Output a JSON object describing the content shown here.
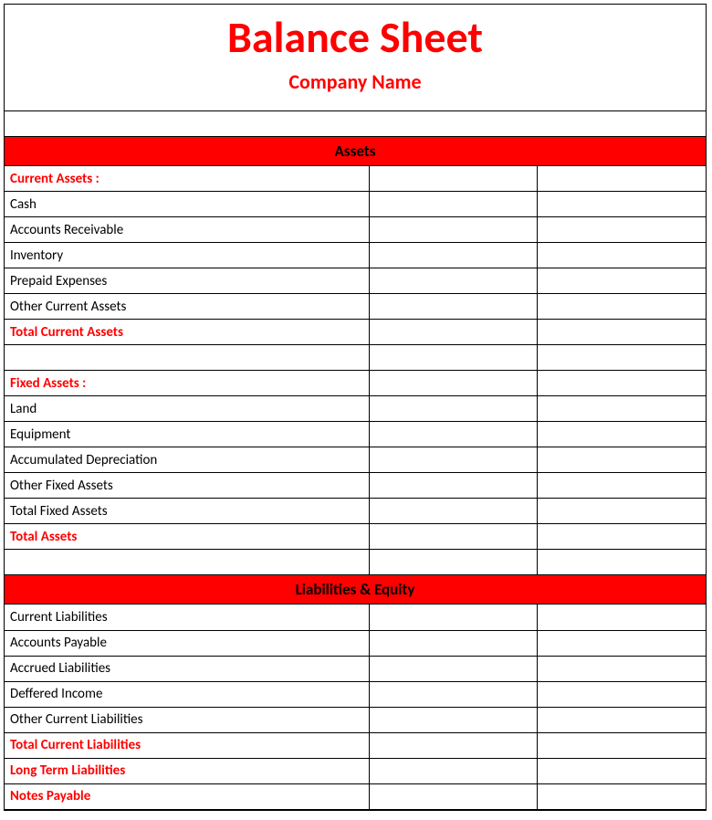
{
  "header": {
    "title": "Balance Sheet",
    "subtitle": "Company Name"
  },
  "sections": {
    "assets": {
      "heading": "Assets",
      "rows": [
        {
          "label": "Current Assets :",
          "style": "red-bold",
          "col_a": "",
          "col_b": ""
        },
        {
          "label": "Cash",
          "style": "plain",
          "col_a": "",
          "col_b": ""
        },
        {
          "label": "Accounts Receivable",
          "style": "plain",
          "col_a": "",
          "col_b": ""
        },
        {
          "label": "Inventory",
          "style": "plain",
          "col_a": "",
          "col_b": ""
        },
        {
          "label": "Prepaid Expenses",
          "style": "plain",
          "col_a": "",
          "col_b": ""
        },
        {
          "label": "Other Current Assets",
          "style": "plain",
          "col_a": "",
          "col_b": ""
        },
        {
          "label": "Total Current Assets",
          "style": "red-bold",
          "col_a": "",
          "col_b": ""
        },
        {
          "label": "",
          "style": "plain",
          "col_a": "",
          "col_b": ""
        },
        {
          "label": "Fixed Assets :",
          "style": "red-bold",
          "col_a": "",
          "col_b": ""
        },
        {
          "label": "Land",
          "style": "plain",
          "col_a": "",
          "col_b": ""
        },
        {
          "label": "Equipment",
          "style": "plain",
          "col_a": "",
          "col_b": ""
        },
        {
          "label": "Accumulated Depreciation",
          "style": "plain",
          "col_a": "",
          "col_b": ""
        },
        {
          "label": "Other Fixed Assets",
          "style": "plain",
          "col_a": "",
          "col_b": ""
        },
        {
          "label": "Total Fixed Assets",
          "style": "plain",
          "col_a": "",
          "col_b": ""
        },
        {
          "label": "Total Assets",
          "style": "red-bold",
          "col_a": "",
          "col_b": ""
        },
        {
          "label": "",
          "style": "plain",
          "col_a": "",
          "col_b": ""
        }
      ]
    },
    "liabilities": {
      "heading": "Liabilities & Equity",
      "rows": [
        {
          "label": "Current Liabilities",
          "style": "plain",
          "col_a": "",
          "col_b": ""
        },
        {
          "label": "Accounts Payable",
          "style": "plain",
          "col_a": "",
          "col_b": ""
        },
        {
          "label": "Accrued Liabilities",
          "style": "plain",
          "col_a": "",
          "col_b": ""
        },
        {
          "label": "Deffered Income",
          "style": "plain",
          "col_a": "",
          "col_b": ""
        },
        {
          "label": "Other Current Liabilities",
          "style": "plain",
          "col_a": "",
          "col_b": ""
        },
        {
          "label": "Total Current Liabilities",
          "style": "red-bold",
          "col_a": "",
          "col_b": ""
        },
        {
          "label": "Long Term Liabilities",
          "style": "red-bold",
          "col_a": "",
          "col_b": ""
        },
        {
          "label": "Notes Payable",
          "style": "red-bold",
          "col_a": "",
          "col_b": ""
        }
      ]
    }
  }
}
